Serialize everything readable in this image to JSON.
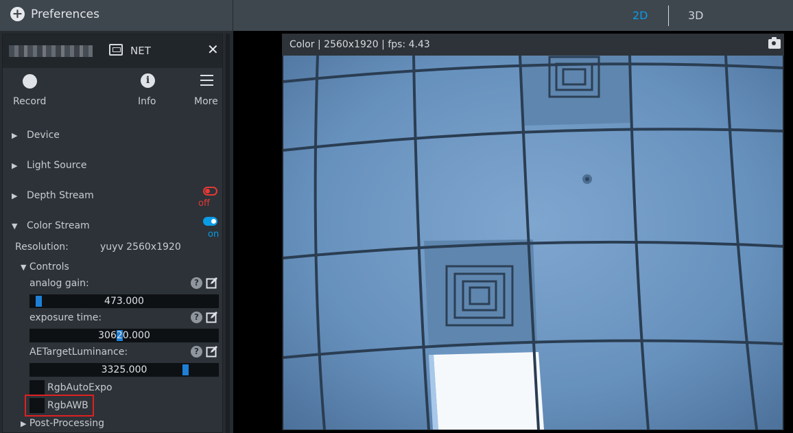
{
  "header": {
    "preferences_label": "Preferences",
    "tab_2d": "2D",
    "tab_3d": "3D",
    "active_tab": "2D"
  },
  "device": {
    "connection": "NET",
    "buttons": {
      "record": "Record",
      "info": "Info",
      "more": "More"
    }
  },
  "sections": {
    "device": "Device",
    "light_source": "Light Source",
    "depth_stream": "Depth Stream",
    "depth_state": "off",
    "color_stream": "Color Stream",
    "color_state": "on",
    "post_processing": "Post-Processing"
  },
  "color_stream": {
    "resolution_label": "Resolution:",
    "resolution_value": "yuyv 2560x1920",
    "controls_label": "Controls",
    "controls": [
      {
        "label": "analog gain:",
        "value": "473.000",
        "level": 0.02
      },
      {
        "label": "exposure time:",
        "value": "30620.000",
        "level": 0.46
      },
      {
        "label": "AETargetLuminance:",
        "value": "3325.000",
        "level": 0.82
      }
    ],
    "checkboxes": [
      {
        "label": "RgbAutoExpo",
        "checked": false
      },
      {
        "label": "RgbAWB",
        "checked": false
      }
    ]
  },
  "viewer": {
    "info": "Color | 2560x1920 | fps: 4.43"
  },
  "colors": {
    "accent": "#0b9ce6",
    "off_red": "#e53935",
    "highlight_red": "#e02020"
  },
  "icons": [
    "plus-circle-icon",
    "network-icon",
    "close-icon",
    "record-icon",
    "info-icon",
    "menu-icon",
    "help-icon",
    "edit-icon",
    "camera-icon"
  ]
}
